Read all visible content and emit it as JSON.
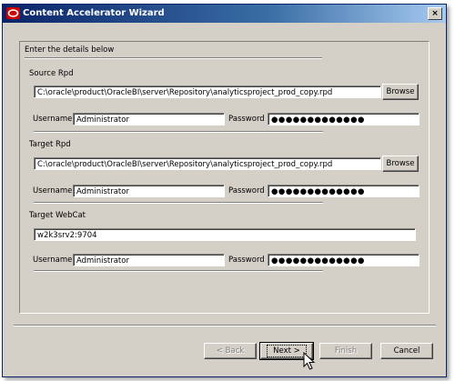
{
  "window": {
    "title": "Content Accelerator Wizard",
    "close_glyph": "×",
    "icon": "oracle-icon"
  },
  "panel": {
    "instructions": "Enter the details below",
    "source": {
      "heading": "Source Rpd",
      "path": "C:\\oracle\\product\\OracleBI\\server\\Repository\\analyticsproject_prod_copy.rpd",
      "browse_label": "Browse",
      "username_label": "Username",
      "username_value": "Administrator",
      "password_label": "Password",
      "password_mask": "●●●●●●●●●●●●●"
    },
    "target": {
      "heading": "Target Rpd",
      "path": "C:\\oracle\\product\\OracleBI\\server\\Repository\\analyticsproject_prod_copy.rpd",
      "browse_label": "Browse",
      "username_label": "Username",
      "username_value": "Administrator",
      "password_label": "Password",
      "password_mask": "●●●●●●●●●●●●●"
    },
    "webcat": {
      "heading": "Target WebCat",
      "server": "w2k3srv2:9704",
      "username_label": "Username",
      "username_value": "Administrator",
      "password_label": "Password",
      "password_mask": "●●●●●●●●●●●●●"
    }
  },
  "buttons": {
    "back": "< Back",
    "next": "Next >",
    "finish": "Finish",
    "cancel": "Cancel"
  },
  "colors": {
    "titlebar_start": "#0a246a",
    "titlebar_end": "#a6caf0",
    "dialog_face": "#d4d0c8"
  }
}
